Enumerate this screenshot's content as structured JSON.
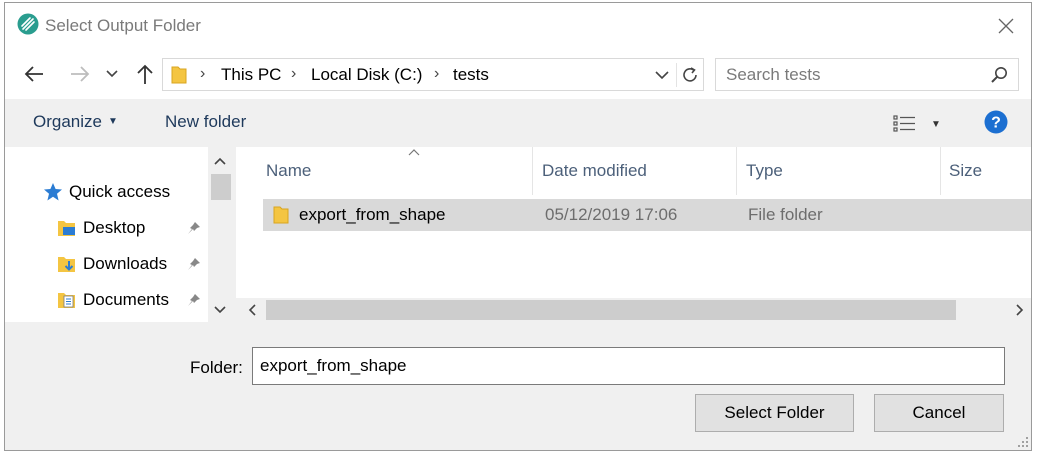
{
  "window": {
    "title": "Select Output Folder"
  },
  "nav": {
    "breadcrumbs": [
      "This PC",
      "Local Disk (C:)",
      "tests"
    ],
    "search_placeholder": "Search tests"
  },
  "toolbar": {
    "organize_label": "Organize",
    "new_folder_label": "New folder"
  },
  "nav_pane": {
    "items": [
      {
        "label": "Quick access",
        "icon": "star-icon"
      },
      {
        "label": "Desktop",
        "icon": "desktop-folder-icon",
        "pinned": true
      },
      {
        "label": "Downloads",
        "icon": "downloads-folder-icon",
        "pinned": true
      },
      {
        "label": "Documents",
        "icon": "documents-folder-icon",
        "pinned": true
      }
    ]
  },
  "file_list": {
    "columns": [
      "Name",
      "Date modified",
      "Type",
      "Size"
    ],
    "rows": [
      {
        "name": "export_from_shape",
        "date": "05/12/2019 17:06",
        "type": "File folder",
        "size": ""
      }
    ]
  },
  "footer": {
    "folder_label": "Folder:",
    "folder_value": "export_from_shape",
    "select_label": "Select Folder",
    "cancel_label": "Cancel"
  },
  "colors": {
    "accent": "#1e73be",
    "selected_row": "#d9d9d9",
    "folder_yellow": "#f4c542",
    "help_blue": "#1c6fd1"
  }
}
